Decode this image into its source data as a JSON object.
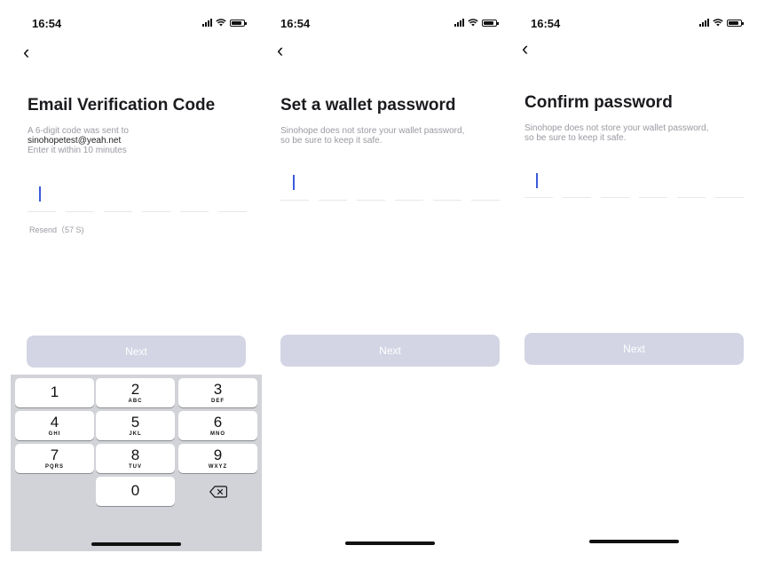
{
  "status_time": "16:54",
  "screens": [
    {
      "title": "Email Verification Code",
      "subtitle_line1": "A 6-digit code was sent to",
      "subtitle_email": "sinohopetest@yeah.net",
      "subtitle_line3": "Enter it within 10 minutes",
      "resend": "Resend（57 S)",
      "next_label": "Next"
    },
    {
      "title": "Set a wallet password",
      "subtitle_line1": "Sinohope does not store your wallet password,",
      "subtitle_line2": "so be sure to keep it safe.",
      "next_label": "Next"
    },
    {
      "title": "Confirm password",
      "subtitle_line1": "Sinohope does not store your wallet password,",
      "subtitle_line2": "so be sure to keep it safe.",
      "next_label": "Next"
    }
  ],
  "keyboard": {
    "keys": [
      {
        "num": "1",
        "letters": ""
      },
      {
        "num": "2",
        "letters": "ABC"
      },
      {
        "num": "3",
        "letters": "DEF"
      },
      {
        "num": "4",
        "letters": "GHI"
      },
      {
        "num": "5",
        "letters": "JKL"
      },
      {
        "num": "6",
        "letters": "MNO"
      },
      {
        "num": "7",
        "letters": "PQRS"
      },
      {
        "num": "8",
        "letters": "TUV"
      },
      {
        "num": "9",
        "letters": "WXYZ"
      },
      {
        "num": "0",
        "letters": ""
      }
    ],
    "delete_icon": "backspace-icon"
  },
  "colors": {
    "button_disabled": "#d3d5e4",
    "cursor": "#3b5bdb",
    "keyboard_bg": "#d1d3d8"
  }
}
